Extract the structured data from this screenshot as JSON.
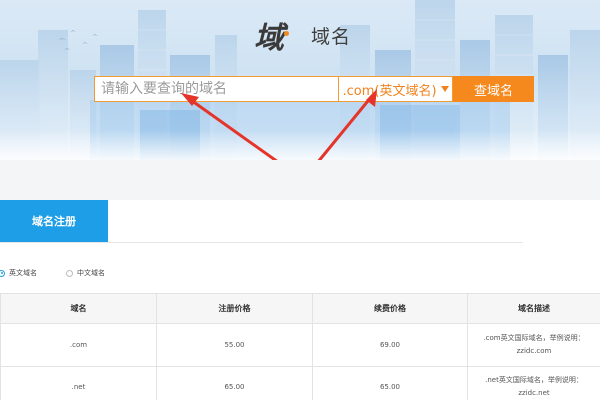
{
  "brand": {
    "logo_glyph": "域",
    "title": "域名",
    "accent_color": "#f5891d",
    "tab_color": "#1d9ee6"
  },
  "search": {
    "placeholder": "请输入要查询的域名",
    "suffix_selected": ".com(英文域名)",
    "button_label": "查域名"
  },
  "tabs": [
    {
      "label": "域名注册",
      "active": true
    }
  ],
  "radio_options": [
    {
      "label": "英文域名",
      "checked": true
    },
    {
      "label": "中文域名",
      "checked": false
    }
  ],
  "table": {
    "headers": [
      "域名",
      "注册价格",
      "续费价格",
      "域名描述"
    ],
    "rows": [
      {
        "name": ".com",
        "register": "55.00",
        "renew": "69.00",
        "desc_line1": ".com英文国际域名，举例说明：",
        "desc_line2": "zzidc.com"
      },
      {
        "name": ".net",
        "register": "65.00",
        "renew": "65.00",
        "desc_line1": ".net英文国际域名，举例说明：",
        "desc_line2": "zzidc.net"
      }
    ]
  }
}
